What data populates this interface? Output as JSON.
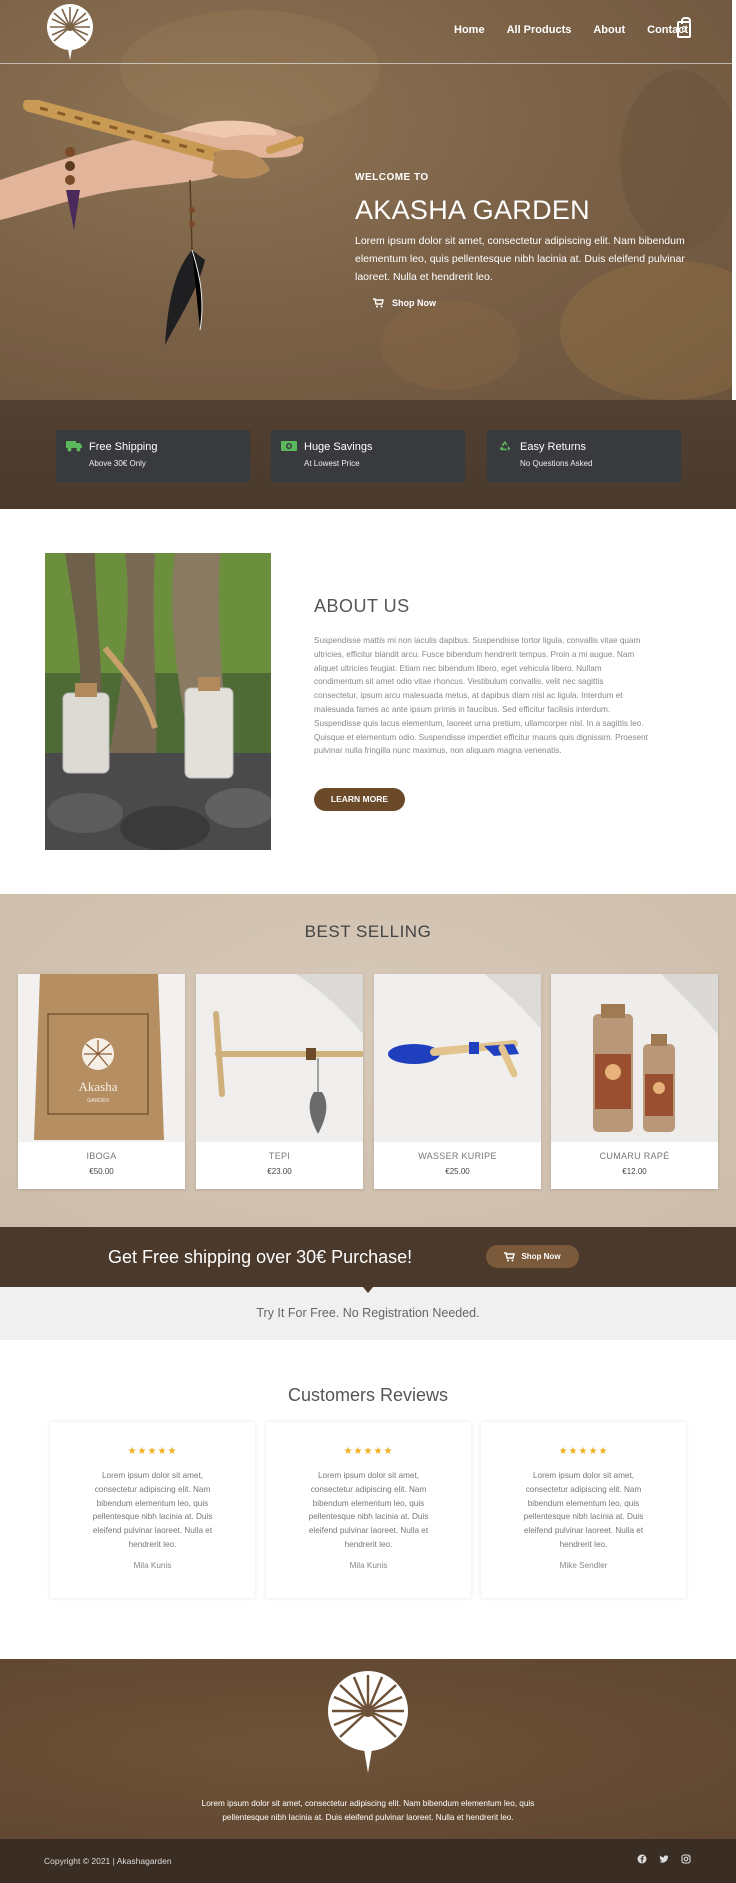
{
  "nav": {
    "links": [
      "Home",
      "All Products",
      "About",
      "Contact"
    ],
    "cart_count": "0"
  },
  "hero": {
    "welcome": "WELCOME TO",
    "title": "AKASHA GARDEN",
    "description": "Lorem ipsum dolor sit amet, consectetur adipiscing elit. Nam bibendum elementum leo, quis pellentesque nibh lacinia at. Duis eleifend pulvinar laoreet. Nulla et hendrerit leo.",
    "button": "Shop Now"
  },
  "features": [
    {
      "title": "Free Shipping",
      "subtitle": "Above 30€ Only",
      "icon": "truck-icon"
    },
    {
      "title": "Huge Savings",
      "subtitle": "At Lowest Price",
      "icon": "money-icon"
    },
    {
      "title": "Easy Returns",
      "subtitle": "No Questions Asked",
      "icon": "recycle-icon"
    }
  ],
  "about": {
    "title": "ABOUT US",
    "text": "Suspendisse mattis mi non iaculis dapibus. Suspendisse tortor ligula, convallis vitae quam ultricies, efficitur blandit arcu. Fusce bibendum hendrerit tempus. Proin a mi augue. Nam aliquet ultricies feugiat. Etiam nec bibendum libero, eget vehicula libero. Nullam condimentum sit amet odio vitae rhoncus. Vestibulum convallis, velit nec sagittis consectetur, ipsum arcu malesuada metus, at dapibus diam nisl ac ligula. Interdum et malesuada fames ac ante ipsum primis in faucibus. Sed efficitur facilisis interdum. Suspendisse quis lacus elementum, laoreet urna pretium, ullamcorper nisl. In a sagittis leo. Quisque et elementum odio. Suspendisse imperdiet efficitur mauris quis dignissim. Proesent pulvinar nulla fringilla nunc maximus, non aliquam magna venenatis.",
    "button": "LEARN MORE"
  },
  "best_selling": {
    "title": "BEST SELLING",
    "products": [
      {
        "name": "IBOGA",
        "price": "€50.00"
      },
      {
        "name": "TEPI",
        "price": "€23.00"
      },
      {
        "name": "WASSER KURIPE",
        "price": "€25.00"
      },
      {
        "name": "CUMARU RAPÉ",
        "price": "€12.00"
      }
    ],
    "package_label": "Akasha",
    "package_sublabel": "GARDEN"
  },
  "promo": {
    "text": "Get Free shipping over 30€ Purchase!",
    "button": "Shop Now",
    "try_text": "Try It For Free. No Registration Needed."
  },
  "reviews": {
    "title": "Customers Reviews",
    "items": [
      {
        "stars": "★★★★★",
        "text": "Lorem ipsum dolor sit amet, consectetur adipiscing elit. Nam bibendum elementum leo, quis pellentesque nibh lacinia at. Duis eleifend pulvinar laoreet. Nulla et hendrerit leo.",
        "name": "Mila Kunis"
      },
      {
        "stars": "★★★★★",
        "text": "Lorem ipsum dolor sit amet, consectetur adipiscing elit. Nam bibendum elementum leo, quis pellentesque nibh lacinia at. Duis eleifend pulvinar laoreet. Nulla et hendrerit leo.",
        "name": "Mila Kunis"
      },
      {
        "stars": "★★★★★",
        "text": "Lorem ipsum dolor sit amet, consectetur adipiscing elit. Nam bibendum elementum leo, quis pellentesque nibh lacinia at. Duis eleifend pulvinar laoreet. Nulla et hendrerit leo.",
        "name": "Mike Sendler"
      }
    ]
  },
  "footer": {
    "text": "Lorem ipsum dolor sit amet, consectetur adipiscing elit. Nam bibendum elementum leo, quis pellentesque nibh lacinia at. Duis eleifend pulvinar laoreet. Nulla et hendrerit leo.",
    "copyright": "Copyright © 2021 | Akashagarden",
    "socials": [
      "facebook-icon",
      "twitter-icon",
      "instagram-icon"
    ]
  },
  "colors": {
    "brand_brown": "#6b4a2a",
    "dark_brown": "#4b3a2c",
    "star": "#f2b01e",
    "feature_icon": "#5cb85c"
  }
}
